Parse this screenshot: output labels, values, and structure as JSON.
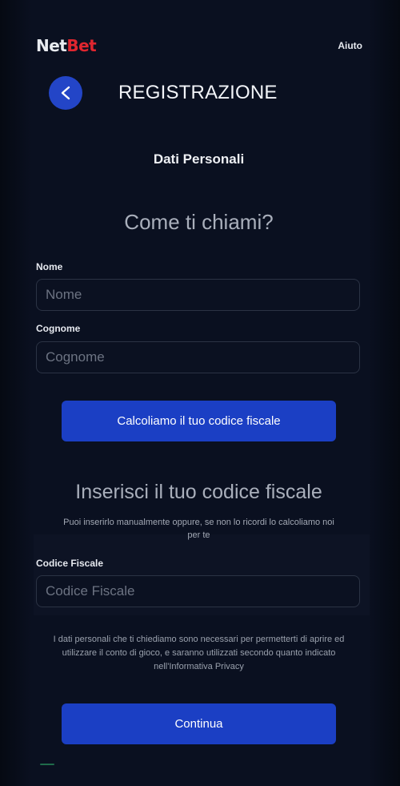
{
  "header": {
    "logo_net": "Net",
    "logo_bet": "Bet",
    "help_label": "Aiuto"
  },
  "page": {
    "title": "REGISTRAZIONE",
    "back_icon": "chevron-left-icon"
  },
  "step": {
    "subtitle": "Dati Personali",
    "question": "Come ti chiami?"
  },
  "form": {
    "first_name": {
      "label": "Nome",
      "placeholder": "Nome",
      "value": ""
    },
    "last_name": {
      "label": "Cognome",
      "placeholder": "Cognome",
      "value": ""
    },
    "calc_button_label": "Calcoliamo il tuo codice fiscale",
    "fiscal_code_heading": "Inserisci il tuo codice fiscale",
    "fiscal_code_hint": "Puoi inserirlo manualmente oppure, se non lo ricordi lo calcoliamo noi per te",
    "fiscal_code": {
      "label": "Codice Fiscale",
      "placeholder": "Codice Fiscale",
      "value": ""
    }
  },
  "privacy_note": "I dati personali che ti chiediamo sono necessari per permetterti di aprire ed utilizzare il conto di gioco, e saranno utilizzati secondo quanto indicato nell'Informativa Privacy",
  "continue_label": "Continua",
  "colors": {
    "background": "#0a1020",
    "accent": "#1b3fc4",
    "brand_red": "#e0262f"
  }
}
